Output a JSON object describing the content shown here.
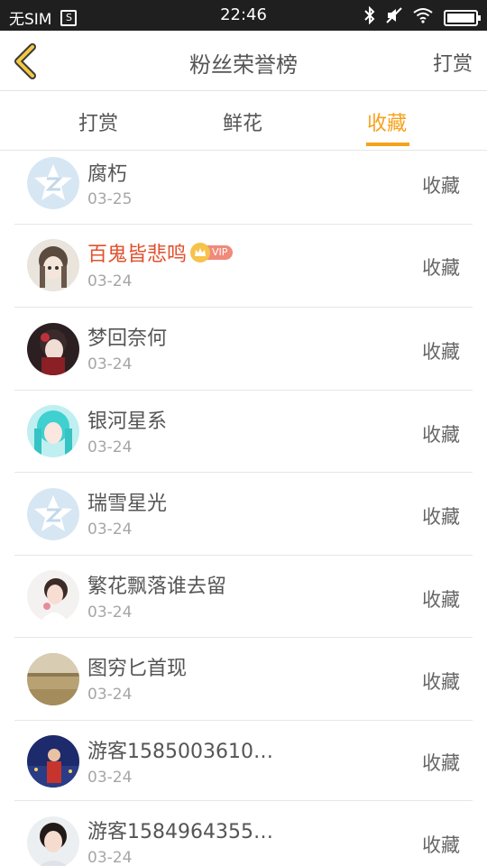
{
  "status_bar": {
    "carrier": "无SIM",
    "sim_icon_text": "S",
    "time": "22:46"
  },
  "header": {
    "title": "粉丝荣誉榜",
    "action": "打赏"
  },
  "tabs": [
    {
      "label": "打赏",
      "active": false
    },
    {
      "label": "鲜花",
      "active": false
    },
    {
      "label": "收藏",
      "active": true
    }
  ],
  "colors": {
    "accent": "#f5a21b",
    "vip_name": "#e2502c",
    "status_bar": "#1f1f1f"
  },
  "fans": [
    {
      "name": "腐朽",
      "date": "03-25",
      "action": "收藏",
      "avatar": "default-q-avatar"
    },
    {
      "name": "百鬼皆悲鸣",
      "date": "03-24",
      "action": "收藏",
      "vip": "VIP",
      "avatar": "anime-girl-avatar"
    },
    {
      "name": "梦回奈何",
      "date": "03-24",
      "action": "收藏",
      "avatar": "dark-anime-avatar"
    },
    {
      "name": "银河星系",
      "date": "03-24",
      "action": "收藏",
      "avatar": "teal-hair-avatar"
    },
    {
      "name": "瑞雪星光",
      "date": "03-24",
      "action": "收藏",
      "avatar": "default-q-avatar"
    },
    {
      "name": "繁花飘落谁去留",
      "date": "03-24",
      "action": "收藏",
      "avatar": "girl-photo-avatar"
    },
    {
      "name": "图穷匕首现",
      "date": "03-24",
      "action": "收藏",
      "avatar": "landscape-avatar"
    },
    {
      "name": "游客1585003610…",
      "date": "03-24",
      "action": "收藏",
      "avatar": "night-photo-avatar"
    },
    {
      "name": "游客1584964355…",
      "date": "03-24",
      "action": "收藏",
      "avatar": "portrait-photo-avatar"
    }
  ]
}
